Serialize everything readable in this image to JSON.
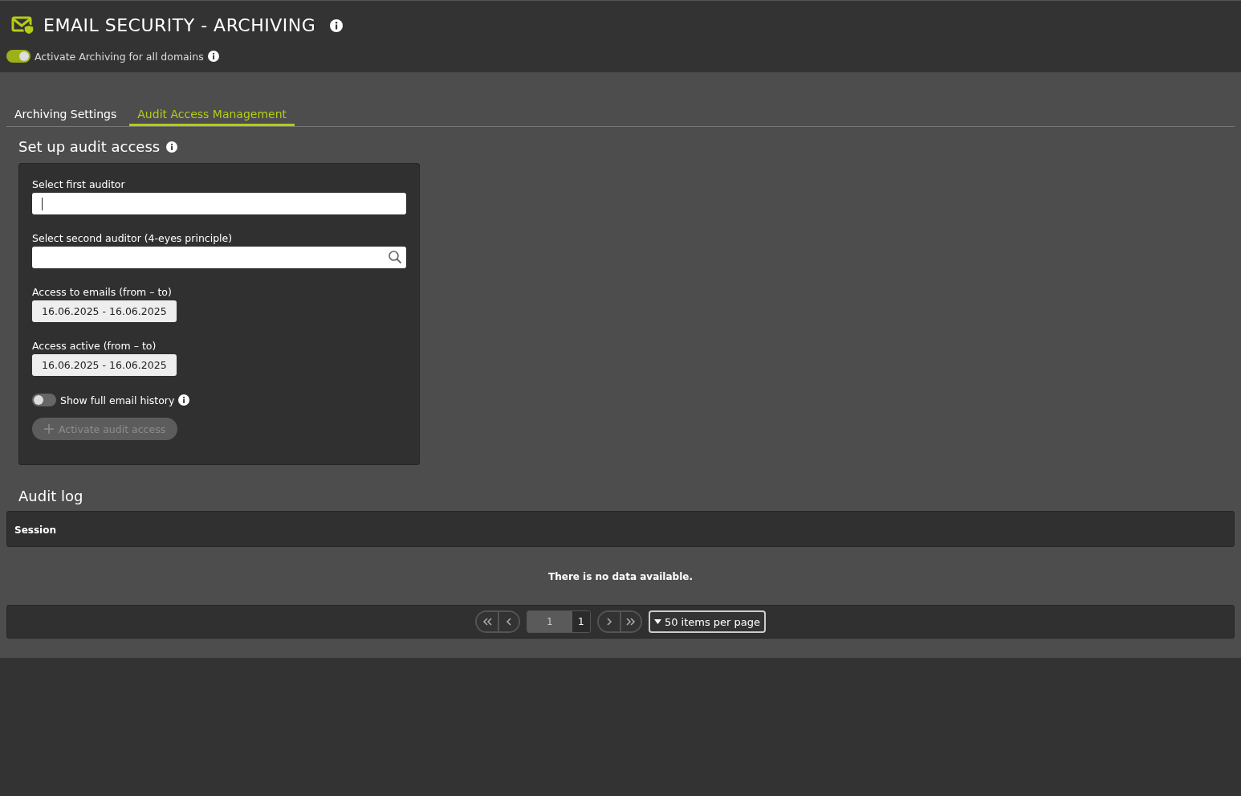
{
  "header": {
    "title": "EMAIL SECURITY - ARCHIVING",
    "toggle": {
      "label": "Activate Archiving for all domains",
      "on": true
    }
  },
  "tabs": [
    {
      "label": "Archiving Settings",
      "selected": false
    },
    {
      "label": "Audit Access Management",
      "selected": true
    }
  ],
  "setup": {
    "heading": "Set up audit access",
    "fields": [
      {
        "kind": "text",
        "label": "Select first auditor",
        "focused": true
      },
      {
        "kind": "search",
        "label": "Select second auditor (4-eyes principle)"
      },
      {
        "kind": "date",
        "label": "Access to emails (from – to)",
        "value": "16.06.2025 - 16.06.2025"
      },
      {
        "kind": "date",
        "label": "Access active (from – to)",
        "value": "16.06.2025 - 16.06.2025"
      },
      {
        "kind": "toggle",
        "label": "Show full email history",
        "on": false
      }
    ],
    "button": {
      "label": "Activate audit access",
      "disabled": true
    }
  },
  "audit_log": {
    "heading": "Audit log",
    "columns": [
      "Session"
    ],
    "empty_message": "There is no data available.",
    "pagination": {
      "page": "1",
      "total_pages": "1",
      "page_size": "50 items per page"
    }
  }
}
